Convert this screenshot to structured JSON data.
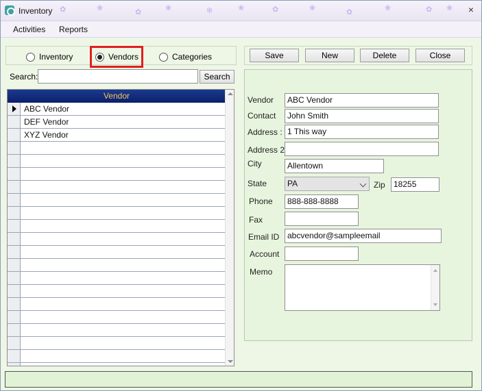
{
  "window": {
    "title": "Inventory",
    "close_glyph": "×"
  },
  "menu": {
    "items": [
      "Activities",
      "Reports"
    ]
  },
  "view_selector": {
    "options": [
      "Inventory",
      "Vendors",
      "Categories"
    ],
    "selected": "Vendors"
  },
  "search": {
    "label": "Search:",
    "value": "",
    "button_label": "Search"
  },
  "grid": {
    "column_header": "Vendor",
    "rows": [
      "ABC Vendor",
      "DEF Vendor",
      "XYZ Vendor"
    ],
    "selected_row": 0
  },
  "toolbar": {
    "save_label": "Save",
    "new_label": "New",
    "delete_label": "Delete",
    "close_label": "Close"
  },
  "form": {
    "vendor_label": "Vendor",
    "vendor_value": "ABC Vendor",
    "contact_label": "Contact",
    "contact_value": "John Smith",
    "address_label": "Address :",
    "address_value": "1 This way",
    "address2_label": "Address 2",
    "address2_value": "",
    "city_label": "City",
    "city_value": "Allentown",
    "state_label": "State",
    "state_value": "PA",
    "zip_label": "Zip",
    "zip_value": "18255",
    "phone_label": "Phone",
    "phone_value": "888-888-8888",
    "fax_label": "Fax",
    "fax_value": "",
    "email_label": "Email ID",
    "email_value": "abcvendor@sampleemail",
    "account_label": "Account",
    "account_value": "",
    "memo_label": "Memo",
    "memo_value": ""
  },
  "colors": {
    "highlight": "#e01e1e",
    "grid_header_bg": "#0c1f6a",
    "grid_header_text": "#f2c65a",
    "panel_bg": "#e8f5de"
  },
  "icons": {
    "app": "app-icon",
    "close": "close-icon",
    "row_pointer": "row-pointer-icon",
    "dropdown": "chevron-down-icon"
  }
}
